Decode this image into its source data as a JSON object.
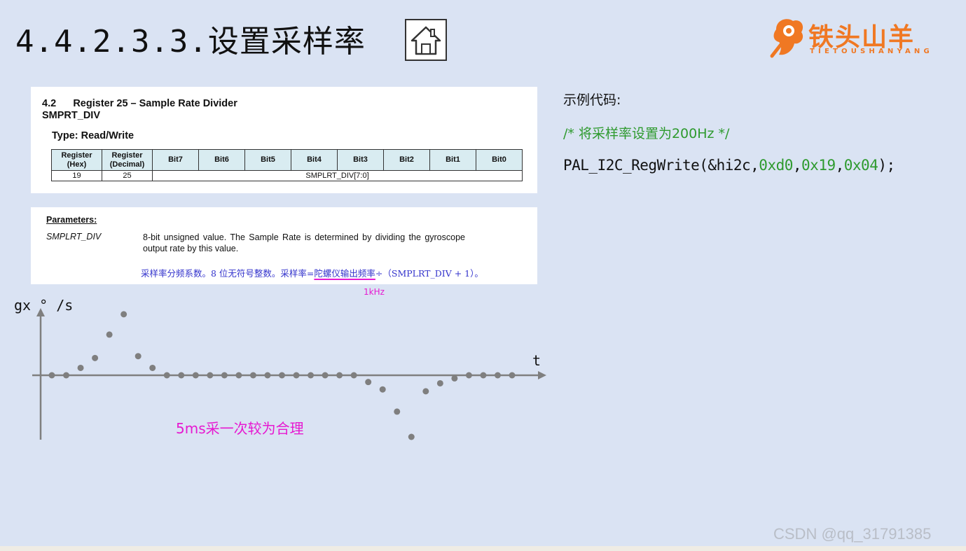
{
  "slide": {
    "title": "4.4.2.3.3.设置采样率",
    "home_icon": "home-icon",
    "logo": {
      "text": "铁头山羊",
      "sub": "TIETOUSHANYANG",
      "color": "#f07823"
    }
  },
  "register": {
    "heading_line1": "4.2      Register 25 – Sample Rate Divider",
    "heading_line2": "SMPRT_DIV",
    "type": "Type: Read/Write",
    "headers": [
      "Register (Hex)",
      "Register (Decimal)",
      "Bit7",
      "Bit6",
      "Bit5",
      "Bit4",
      "Bit3",
      "Bit2",
      "Bit1",
      "Bit0"
    ],
    "row": {
      "hex": "19",
      "decimal": "25",
      "field": "SMPLRT_DIV[7:0]"
    }
  },
  "parameters": {
    "label": "Parameters:",
    "name": "SMPLRT_DIV",
    "description": "8-bit unsigned value. The Sample Rate is determined by dividing the gyroscope output rate by this value.",
    "cn_before": "采样率分频系数。8 位无符号整数。采样率=",
    "cn_highlight": "陀螺仪输出频率",
    "cn_after": "÷（SMPLRT_DIV + 1）。",
    "note": "1kHz"
  },
  "code": {
    "label": "示例代码:",
    "comment": "/* 将采样率设置为200Hz */",
    "func": "PAL_I2C_RegWrite(&hi2c,",
    "arg1": "0xd0",
    "sep1": ",",
    "arg2": "0x19",
    "sep2": ",",
    "arg3": "0x04",
    "end": ");"
  },
  "chart_data": {
    "type": "scatter",
    "title": "",
    "ylabel": "gx ° /s",
    "xlabel": "t",
    "annotation": "5ms采一次较为合理",
    "x": [
      0,
      1,
      2,
      3,
      4,
      5,
      6,
      7,
      8,
      9,
      10,
      11,
      12,
      13,
      14,
      15,
      16,
      17,
      18,
      19,
      20,
      21,
      22,
      23,
      24,
      25,
      26,
      27,
      28,
      29,
      30,
      31,
      32
    ],
    "y": [
      0,
      0,
      0.12,
      0.28,
      0.66,
      0.99,
      0.31,
      0.12,
      0,
      0,
      0,
      0,
      0,
      0,
      0,
      0,
      0,
      0,
      0,
      0,
      0,
      0,
      -0.11,
      -0.23,
      -0.59,
      -1.0,
      -0.26,
      -0.13,
      -0.05,
      0,
      0,
      0,
      0
    ],
    "ylim": [
      -1.1,
      1.1
    ],
    "xlim": [
      -1,
      34
    ],
    "point_color": "#7f7f7f",
    "axis_color": "#7f7f7f",
    "grid": false
  },
  "watermark": "CSDN @qq_31791385"
}
